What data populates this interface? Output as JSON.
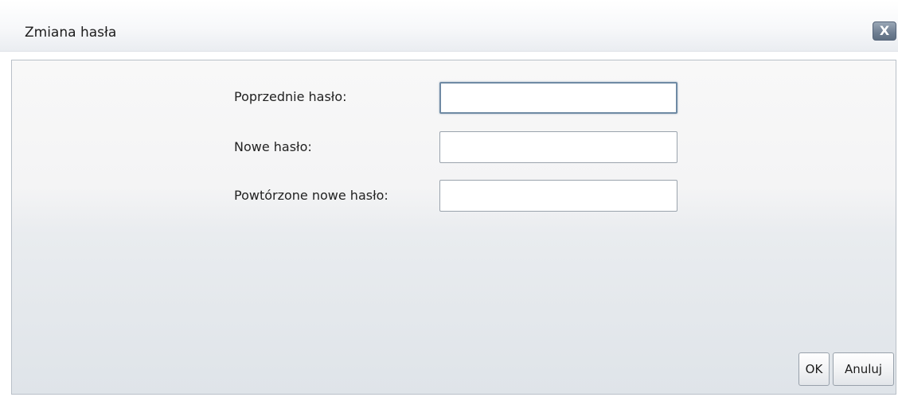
{
  "dialog": {
    "title": "Zmiana hasła",
    "close_label": "X"
  },
  "form": {
    "fields": [
      {
        "label": "Poprzednie hasło:",
        "value": "",
        "placeholder": ""
      },
      {
        "label": "Nowe hasło:",
        "value": "",
        "placeholder": ""
      },
      {
        "label": "Powtórzone nowe hasło:",
        "value": "",
        "placeholder": ""
      }
    ]
  },
  "buttons": {
    "ok_label": "OK",
    "cancel_label": "Anuluj"
  },
  "colors": {
    "panel_border": "#b9c0c8",
    "close_button": "#6f7f92",
    "focus_border": "#6f8aa4"
  },
  "icons": {
    "close": "close-icon"
  }
}
